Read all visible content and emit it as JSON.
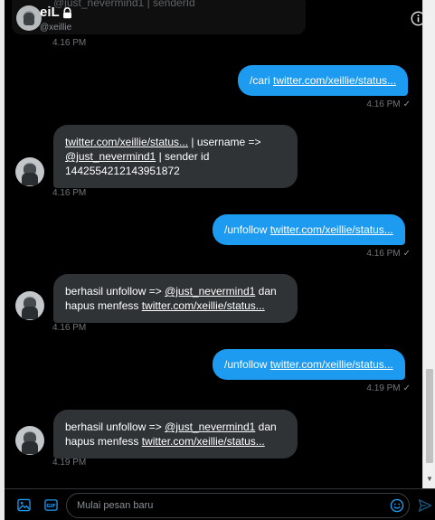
{
  "header": {
    "name": "eiL",
    "handle": "@xeillie",
    "ghost_text": "@just_nevermind1 | senderId"
  },
  "messages": [
    {
      "type": "time",
      "text": "4.16 PM"
    },
    {
      "type": "out",
      "prefix": "/cari ",
      "link": "twitter.com/xeillie/status...",
      "time": "4.16 PM",
      "check": "✓"
    },
    {
      "type": "in",
      "link": "twitter.com/xeillie/status...",
      "line1_rest": " | username =>",
      "mention": "@just_nevermind1",
      "line2_rest": " | sender id",
      "line3": "1442554212143951872",
      "time": "4.16 PM"
    },
    {
      "type": "out",
      "prefix": "/unfollow ",
      "link": "twitter.com/xeillie/status...",
      "time": "4.16 PM",
      "check": "✓"
    },
    {
      "type": "in",
      "line1_pre": "berhasil unfollow => ",
      "mention": "@just_nevermind1",
      "line1_post": " dan",
      "line2_pre": "hapus menfess ",
      "link": "twitter.com/xeillie/status...",
      "time": "4.16 PM"
    },
    {
      "type": "out",
      "prefix": "/unfollow ",
      "link": "twitter.com/xeillie/status...",
      "time": "4.19 PM",
      "check": "✓"
    },
    {
      "type": "in",
      "line1_pre": "berhasil unfollow => ",
      "mention": "@just_nevermind1",
      "line1_post": " dan",
      "line2_pre": "hapus menfess ",
      "link": "twitter.com/xeillie/status...",
      "time": "4.19 PM"
    }
  ],
  "composer": {
    "placeholder": "Mulai pesan baru"
  },
  "icons": {
    "lock": "lock-icon",
    "info": "info-icon",
    "media": "image-icon",
    "gif": "gif-icon",
    "emoji": "emoji-icon",
    "send": "send-icon"
  },
  "colors": {
    "accent": "#1d9bf0",
    "incoming_bubble": "#2f3336",
    "background": "#000000"
  }
}
